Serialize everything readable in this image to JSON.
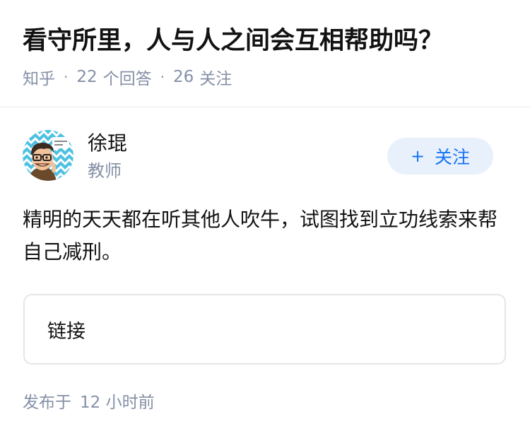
{
  "question": {
    "title": "看守所里，人与人之间会互相帮助吗？",
    "source": "知乎",
    "answers_count": "22",
    "answers_label": "个回答",
    "followers_count": "26",
    "followers_label": "关注"
  },
  "answer": {
    "author": {
      "name": "徐琨",
      "title": "教师",
      "avatar_icon": "cartoon-avatar-icon"
    },
    "follow_button": {
      "label": "关注",
      "icon": "plus-icon",
      "color": "#1772f6",
      "background": "#e8f1fb"
    },
    "content": "精明的天天都在听其他人吹牛，试图找到立功线索来帮自己减刑。",
    "link_card": {
      "label": "链接"
    },
    "publish": {
      "prefix": "发布于",
      "time": "12 小时前"
    }
  },
  "colors": {
    "primary_text": "#121212",
    "secondary_text": "#8590a6",
    "divider": "#ebebeb",
    "card_border": "#e6e6e6"
  }
}
